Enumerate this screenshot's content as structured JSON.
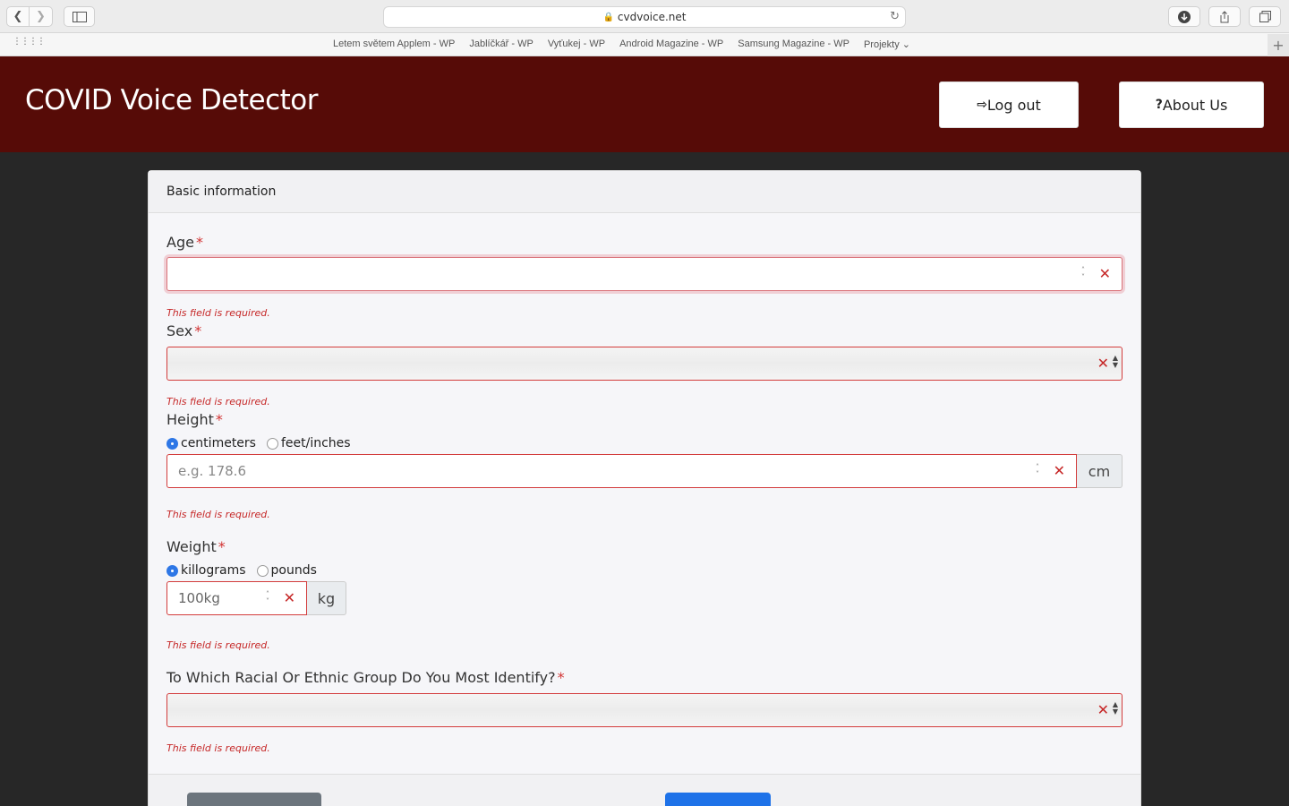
{
  "browser": {
    "url": "cvdvoice.net",
    "favorites": [
      "Letem světem Applem - WP",
      "Jablíčkář - WP",
      "Vyťukej - WP",
      "Android Magazine - WP",
      "Samsung Magazine - WP",
      "Projekty"
    ]
  },
  "header": {
    "title": "COVID Voice Detector",
    "logout_label": "Log out",
    "about_label": "About Us"
  },
  "form": {
    "section_title": "Basic information",
    "required_marker": "*",
    "error_text": "This field is required.",
    "age": {
      "label": "Age",
      "value": ""
    },
    "sex": {
      "label": "Sex",
      "value": ""
    },
    "height": {
      "label": "Height",
      "unit_options": [
        "centimeters",
        "feet/inches"
      ],
      "selected_unit": "centimeters",
      "placeholder": "e.g. 178.6",
      "addon": "cm"
    },
    "weight": {
      "label": "Weight",
      "unit_options": [
        "killograms",
        "pounds"
      ],
      "selected_unit": "killograms",
      "placeholder": "100kg",
      "addon": "kg"
    },
    "ethnicity": {
      "label": "To Which Racial Or Ethnic Group Do You Most Identify?",
      "value": ""
    }
  },
  "colors": {
    "header_bg": "#560b07",
    "error": "#c62828",
    "radio_selected": "#2e77e6",
    "primary_button": "#1e72e8",
    "secondary_button": "#6c757d"
  }
}
